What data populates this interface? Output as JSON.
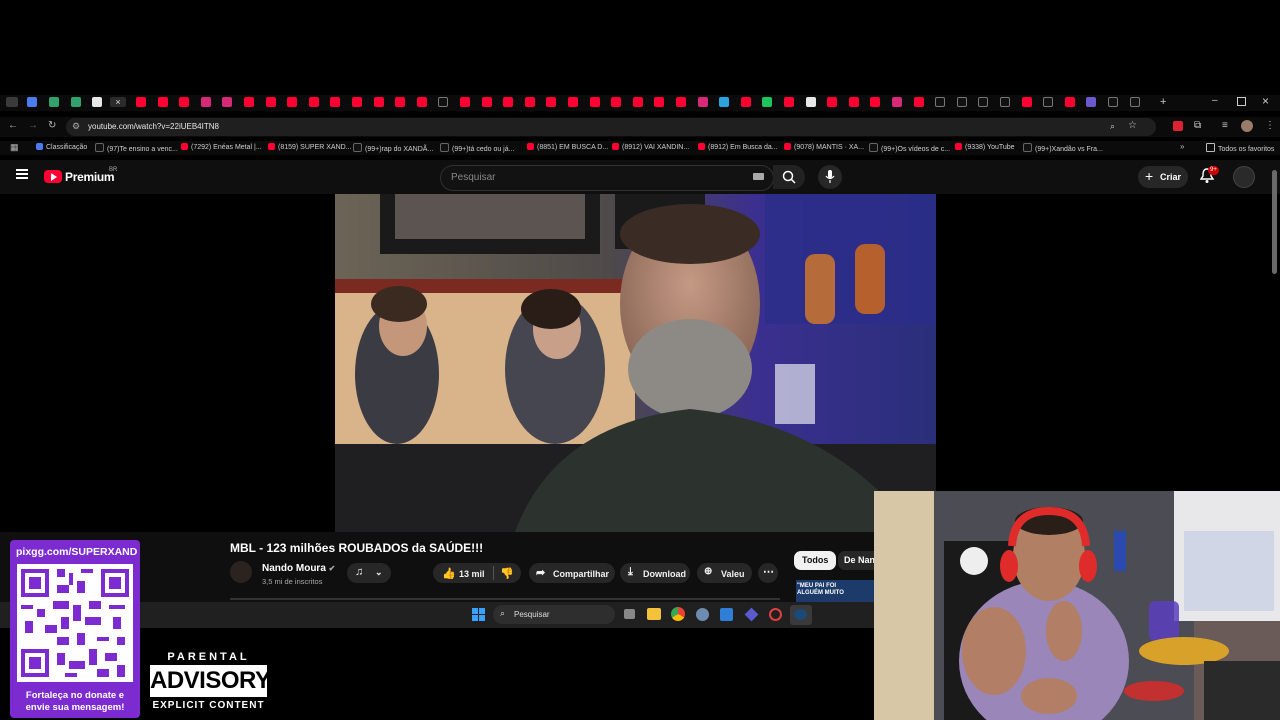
{
  "browser": {
    "url": "youtube.com/watch?v=22iUEB4ITN8",
    "bookmarks": [
      "Classificação",
      "(97)Te ensino a venc...",
      "(7292) Enéas Metal |...",
      "(8159) SUPER XAND...",
      "(99+)rap do XANDÃ...",
      "(99+)tá cedo ou já...",
      "(8851) EM BUSCA D...",
      "(8912) VAI XANDIN...",
      "(8912) Em Busca da...",
      "(9078) MANTIS · XA...",
      "(99+)Os vídeos de c...",
      "(9338) YouTube",
      "(99+)Xandão vs Fra..."
    ],
    "all_favorites": "Todos os favoritos"
  },
  "youtube": {
    "logo": "Premium",
    "region": "BR",
    "search_placeholder": "Pesquisar",
    "create_label": "Criar",
    "notif_count": "9+"
  },
  "video": {
    "title": "MBL - 123 milhões ROUBADOS da SAÚDE!!!",
    "channel": "Nando Moura",
    "subscribers": "3,5 mi de inscritos",
    "likes": "13 mil",
    "share": "Compartilhar",
    "download": "Download",
    "thanks": "Valeu",
    "chip_all": "Todos",
    "chip_from": "De Nan",
    "thumb_text": "\"MEU PAI FOI ALGUÉM MUITO"
  },
  "taskbar": {
    "search": "Pesquisar"
  },
  "overlay": {
    "donate_url": "pixgg.com/SUPERXAND",
    "donate_text": "Fortaleça no donate e envie sua mensagem!",
    "advisory_top": "PARENTAL",
    "advisory_mid": "ADVISORY",
    "advisory_bot": "EXPLICIT CONTENT"
  },
  "colors": {
    "yt_red": "#ff0033",
    "purple": "#7b2bd0",
    "bg": "#0f0f0f"
  }
}
